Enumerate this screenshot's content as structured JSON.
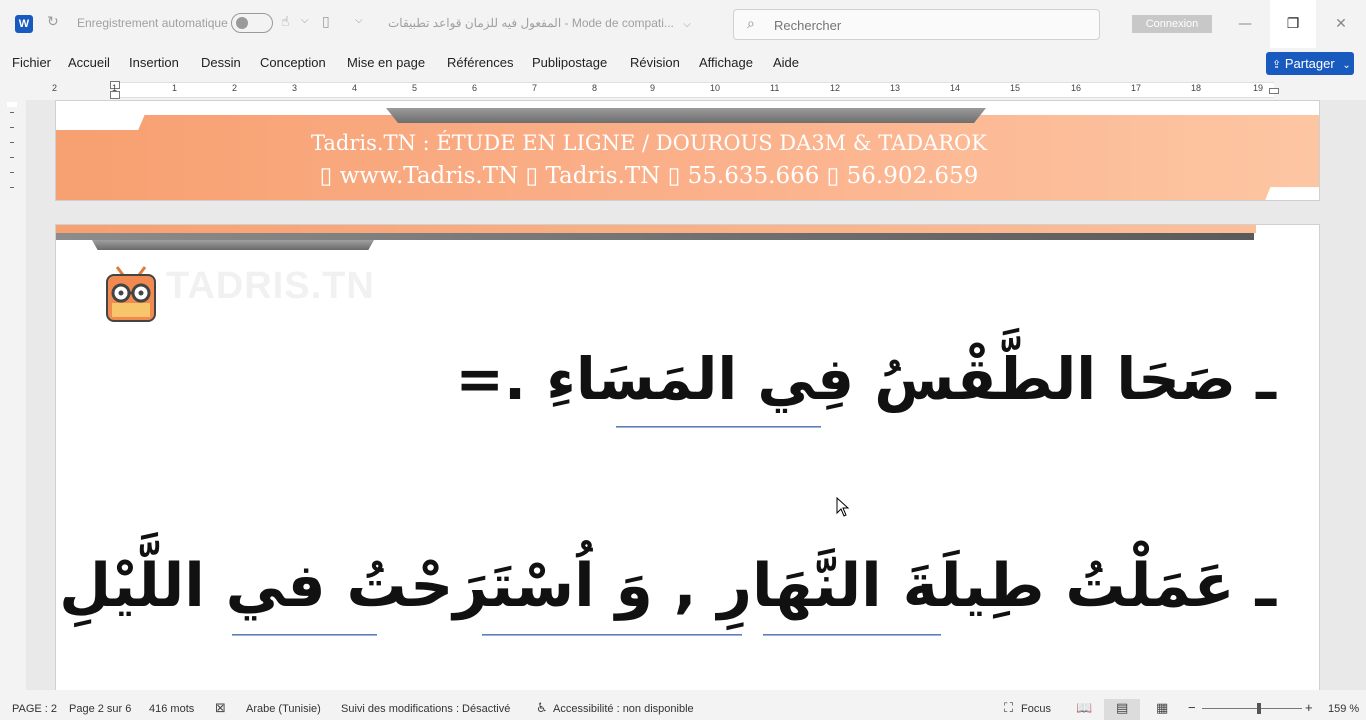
{
  "app": {
    "icon_letter": "W",
    "autosave_label": "Enregistrement automatique",
    "doc_title": "المفعول فيه للزمان قواعد تطبيقات  -  Mode de compati...",
    "doc_title_chevron": "⌵"
  },
  "search": {
    "placeholder": "Rechercher"
  },
  "account": {
    "connexion_label": "Connexion"
  },
  "window_controls": {
    "minimize": "—",
    "restore": "❐",
    "close": "✕"
  },
  "ribbon": {
    "tabs": [
      "Fichier",
      "Accueil",
      "Insertion",
      "Dessin",
      "Conception",
      "Mise en page",
      "Références",
      "Publipostage",
      "Révision",
      "Affichage",
      "Aide"
    ],
    "share_label": "Partager"
  },
  "ruler": {
    "numbers": [
      "2",
      "1",
      "1",
      "2",
      "3",
      "4",
      "5",
      "6",
      "7",
      "8",
      "9",
      "10",
      "11",
      "12",
      "13",
      "14",
      "15",
      "16",
      "17",
      "18",
      "19"
    ]
  },
  "document": {
    "header_line1": "Tadris.TN : ÉTUDE EN LIGNE / DOUROUS DA3M & TADAROK",
    "header_line2": "▯ www.Tadris.TN   ▯  Tadris.TN   ▯ 55.635.666 ▯ 56.902.659",
    "logo_text": "TADRIS.TN",
    "sentence1": "ـ صَحَا الطَّقْسُ فِي المَسَاءِ .=",
    "sentence2": "ـ عَمَلْتُ طِيلَةَ النَّهَارِ , وَ اُسْتَرَحْتُ في اللَّيْلِ ."
  },
  "status": {
    "page": "PAGE : 2",
    "page_of": "Page 2 sur 6",
    "words": "416 mots",
    "language": "Arabe (Tunisie)",
    "track_changes": "Suivi des modifications : Désactivé",
    "accessibility": "Accessibilité : non disponible",
    "focus": "Focus",
    "zoom": "159 %"
  },
  "colors": {
    "brand": "#185abd",
    "header_orange": "#f7a071",
    "underline_blue": "#5a7fb8"
  }
}
